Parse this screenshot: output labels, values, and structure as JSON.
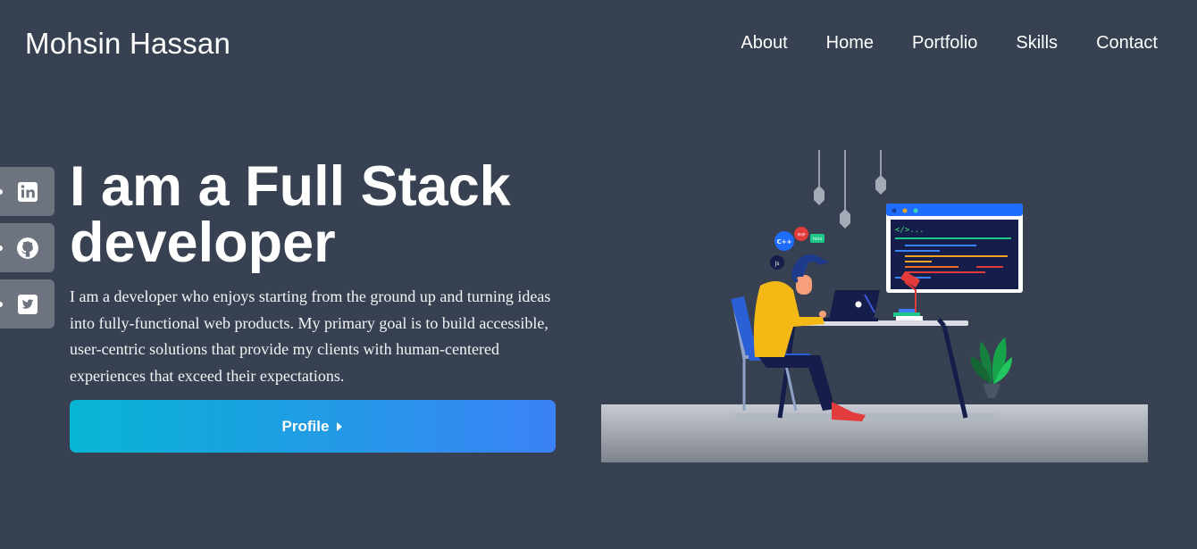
{
  "brand": {
    "name": "Mohsin Hassan"
  },
  "nav": {
    "items": [
      {
        "label": "About"
      },
      {
        "label": "Home"
      },
      {
        "label": "Portfolio"
      },
      {
        "label": "Skills"
      },
      {
        "label": "Contact"
      }
    ]
  },
  "social": {
    "icons": [
      "linkedin-icon",
      "github-icon",
      "twitter-icon"
    ]
  },
  "hero": {
    "headline": "I am a Full Stack developer",
    "bio": "I am a developer who enjoys starting from the ground up and turning ideas into fully-functional web products. My primary goal is to build accessible, user-centric solutions that provide my clients with human-centered experiences that exceed their expectations.",
    "cta_label": "Profile"
  },
  "illustration": {
    "bubbles": [
      "C++",
      "PHP",
      "html",
      "Js"
    ],
    "code_prompt": "</>..."
  },
  "colors": {
    "background": "#384152",
    "cta_gradient_start": "#07b5d4",
    "cta_gradient_end": "#3b82f6",
    "social_button": "#6d7480"
  }
}
